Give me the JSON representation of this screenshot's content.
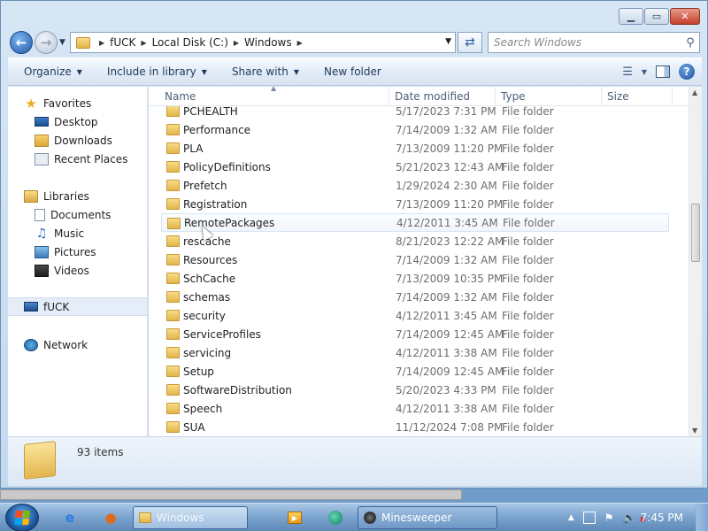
{
  "window": {
    "caption_buttons": {
      "minimize": "▁",
      "maximize": "▭",
      "close": "✕"
    }
  },
  "address": {
    "breadcrumbs": [
      "fUCK",
      "Local Disk (C:)",
      "Windows"
    ],
    "search_placeholder": "Search Windows"
  },
  "toolbar": {
    "organize": "Organize",
    "include_in_library": "Include in library",
    "share_with": "Share with",
    "new_folder": "New folder"
  },
  "nav_pane": {
    "favorites": "Favorites",
    "desktop": "Desktop",
    "downloads": "Downloads",
    "recent_places": "Recent Places",
    "libraries": "Libraries",
    "documents": "Documents",
    "music": "Music",
    "pictures": "Pictures",
    "videos": "Videos",
    "computer": "fUCK",
    "network": "Network"
  },
  "columns": {
    "name": "Name",
    "date_modified": "Date modified",
    "type": "Type",
    "size": "Size"
  },
  "files": [
    {
      "name": "PCHEALTH",
      "date": "5/17/2023 7:31 PM",
      "type": "File folder"
    },
    {
      "name": "Performance",
      "date": "7/14/2009 1:32 AM",
      "type": "File folder"
    },
    {
      "name": "PLA",
      "date": "7/13/2009 11:20 PM",
      "type": "File folder"
    },
    {
      "name": "PolicyDefinitions",
      "date": "5/21/2023 12:43 AM",
      "type": "File folder"
    },
    {
      "name": "Prefetch",
      "date": "1/29/2024 2:30 AM",
      "type": "File folder"
    },
    {
      "name": "Registration",
      "date": "7/13/2009 11:20 PM",
      "type": "File folder"
    },
    {
      "name": "RemotePackages",
      "date": "4/12/2011 3:45 AM",
      "type": "File folder"
    },
    {
      "name": "rescache",
      "date": "8/21/2023 12:22 AM",
      "type": "File folder"
    },
    {
      "name": "Resources",
      "date": "7/14/2009 1:32 AM",
      "type": "File folder"
    },
    {
      "name": "SchCache",
      "date": "7/13/2009 10:35 PM",
      "type": "File folder"
    },
    {
      "name": "schemas",
      "date": "7/14/2009 1:32 AM",
      "type": "File folder"
    },
    {
      "name": "security",
      "date": "4/12/2011 3:45 AM",
      "type": "File folder"
    },
    {
      "name": "ServiceProfiles",
      "date": "7/14/2009 12:45 AM",
      "type": "File folder"
    },
    {
      "name": "servicing",
      "date": "4/12/2011 3:38 AM",
      "type": "File folder"
    },
    {
      "name": "Setup",
      "date": "7/14/2009 12:45 AM",
      "type": "File folder"
    },
    {
      "name": "SoftwareDistribution",
      "date": "5/20/2023 4:33 PM",
      "type": "File folder"
    },
    {
      "name": "Speech",
      "date": "4/12/2011 3:38 AM",
      "type": "File folder"
    },
    {
      "name": "SUA",
      "date": "11/12/2024 7:08 PM",
      "type": "File folder"
    }
  ],
  "details": {
    "item_count": "93 items"
  },
  "taskbar": {
    "explorer_task": "Windows",
    "minesweeper_task": "Minesweeper",
    "clock": "7:45 PM"
  }
}
